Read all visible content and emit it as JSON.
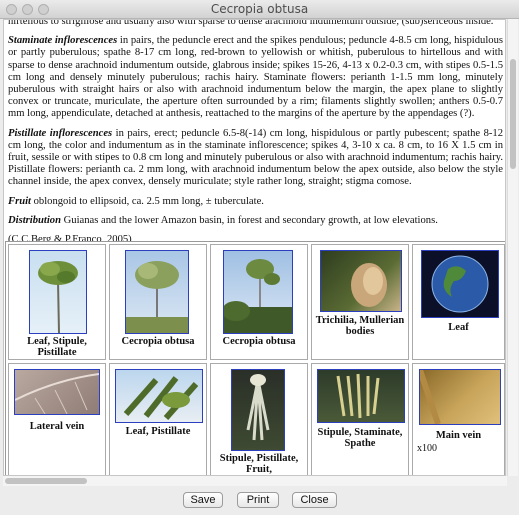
{
  "window": {
    "title": "Cecropia obtusa"
  },
  "paragraphs": [
    {
      "label": "",
      "text": "hirtellous to strigillose and usually also with sparse to dense arachnoid indumentum outside, (sub)sericeous inside."
    },
    {
      "label": "Staminate inflorescences",
      "text": " in pairs, the peduncle erect and the spikes pendulous; peduncle 4-8.5 cm long, hispidulous or partly puberulous; spathe 8-17 cm long, red-brown to yellowish or whitish, puberulous to hirtellous and with sparse to dense arachnoid indumentum outside, glabrous inside; spikes 15-26, 4-13 x 0.2-0.3 cm, with stipes 0.5-1.5 cm long and densely minutely puberulous; rachis hairy. Staminate flowers: perianth 1-1.5 mm long, minutely puberulous with straight hairs or also with arachnoid indumentum below the margin, the apex plane to slightly convex or truncate, muriculate, the aperture often surrounded by a rim; filaments slightly swollen; anthers 0.5-0.7 mm long, appendiculate, detached at anthesis, reattached to the margins of the aperture by the appendages (?)."
    },
    {
      "label": "Pistillate inflorescences",
      "text": " in pairs, erect; peduncle 6.5-8(-14) cm long, hispidulous or partly pubescent; spathe 8-12 cm long, the color and indumentum as in the staminate inflorescence; spikes 4, 3-10 x ca. 8 cm, to 16 X 1.5 cm in fruit, sessile or with stipes to 0.8 cm long and minutely puberulous or also with arachnoid indumentum; rachis hairy. Pistillate flowers: perianth ca. 2 mm long, with arachnoid indumentum below the apex outside, also below the style channel inside, the apex convex, densely muriculate; style rather long, straight; stigma comose."
    },
    {
      "label": "Fruit",
      "text": " oblongoid to ellipsoid, ca. 2.5 mm long, ± tuberculate."
    },
    {
      "label": "Distribution",
      "text": " Guianas and the lower Amazon basin, in forest and secondary growth, at low elevations."
    },
    {
      "label": "",
      "text": "(C.C.Berg & P.Franco, 2005)"
    }
  ],
  "gallery": [
    {
      "caption": "Leaf, Stipule, Pistillate",
      "note": ""
    },
    {
      "caption": "Cecropia obtusa",
      "note": ""
    },
    {
      "caption": "Cecropia obtusa",
      "note": ""
    },
    {
      "caption": "Trichilia, Mullerian bodies",
      "note": ""
    },
    {
      "caption": "Leaf",
      "note": ""
    },
    {
      "caption": "Lateral vein",
      "note": ""
    },
    {
      "caption": "Leaf, Pistillate",
      "note": ""
    },
    {
      "caption": "Stipule, Pistillate, Fruit,",
      "note": ""
    },
    {
      "caption": "Stipule, Staminate, Spathe",
      "note": ""
    },
    {
      "caption": "Main vein",
      "note": "x100"
    }
  ],
  "buttons": {
    "save": "Save",
    "print": "Print",
    "close": "Close"
  }
}
